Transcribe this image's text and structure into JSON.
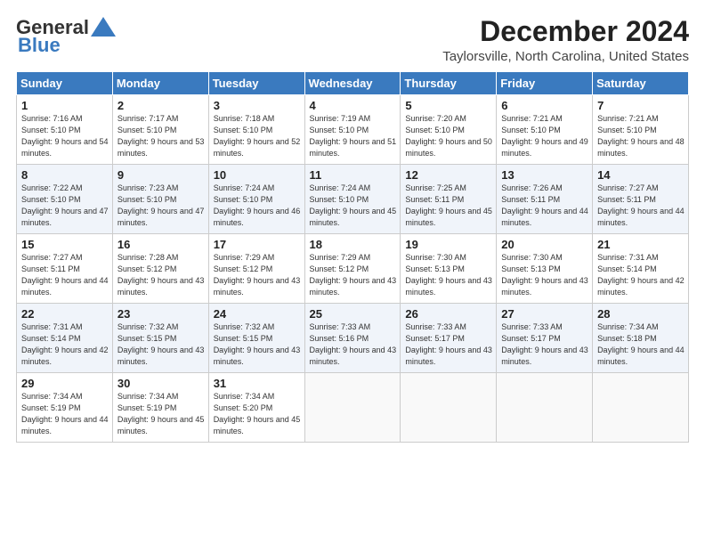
{
  "header": {
    "logo_general": "General",
    "logo_blue": "Blue",
    "month_title": "December 2024",
    "location": "Taylorsville, North Carolina, United States"
  },
  "days_of_week": [
    "Sunday",
    "Monday",
    "Tuesday",
    "Wednesday",
    "Thursday",
    "Friday",
    "Saturday"
  ],
  "weeks": [
    [
      {
        "day": "1",
        "sunrise": "Sunrise: 7:16 AM",
        "sunset": "Sunset: 5:10 PM",
        "daylight": "Daylight: 9 hours and 54 minutes."
      },
      {
        "day": "2",
        "sunrise": "Sunrise: 7:17 AM",
        "sunset": "Sunset: 5:10 PM",
        "daylight": "Daylight: 9 hours and 53 minutes."
      },
      {
        "day": "3",
        "sunrise": "Sunrise: 7:18 AM",
        "sunset": "Sunset: 5:10 PM",
        "daylight": "Daylight: 9 hours and 52 minutes."
      },
      {
        "day": "4",
        "sunrise": "Sunrise: 7:19 AM",
        "sunset": "Sunset: 5:10 PM",
        "daylight": "Daylight: 9 hours and 51 minutes."
      },
      {
        "day": "5",
        "sunrise": "Sunrise: 7:20 AM",
        "sunset": "Sunset: 5:10 PM",
        "daylight": "Daylight: 9 hours and 50 minutes."
      },
      {
        "day": "6",
        "sunrise": "Sunrise: 7:21 AM",
        "sunset": "Sunset: 5:10 PM",
        "daylight": "Daylight: 9 hours and 49 minutes."
      },
      {
        "day": "7",
        "sunrise": "Sunrise: 7:21 AM",
        "sunset": "Sunset: 5:10 PM",
        "daylight": "Daylight: 9 hours and 48 minutes."
      }
    ],
    [
      {
        "day": "8",
        "sunrise": "Sunrise: 7:22 AM",
        "sunset": "Sunset: 5:10 PM",
        "daylight": "Daylight: 9 hours and 47 minutes."
      },
      {
        "day": "9",
        "sunrise": "Sunrise: 7:23 AM",
        "sunset": "Sunset: 5:10 PM",
        "daylight": "Daylight: 9 hours and 47 minutes."
      },
      {
        "day": "10",
        "sunrise": "Sunrise: 7:24 AM",
        "sunset": "Sunset: 5:10 PM",
        "daylight": "Daylight: 9 hours and 46 minutes."
      },
      {
        "day": "11",
        "sunrise": "Sunrise: 7:24 AM",
        "sunset": "Sunset: 5:10 PM",
        "daylight": "Daylight: 9 hours and 45 minutes."
      },
      {
        "day": "12",
        "sunrise": "Sunrise: 7:25 AM",
        "sunset": "Sunset: 5:11 PM",
        "daylight": "Daylight: 9 hours and 45 minutes."
      },
      {
        "day": "13",
        "sunrise": "Sunrise: 7:26 AM",
        "sunset": "Sunset: 5:11 PM",
        "daylight": "Daylight: 9 hours and 44 minutes."
      },
      {
        "day": "14",
        "sunrise": "Sunrise: 7:27 AM",
        "sunset": "Sunset: 5:11 PM",
        "daylight": "Daylight: 9 hours and 44 minutes."
      }
    ],
    [
      {
        "day": "15",
        "sunrise": "Sunrise: 7:27 AM",
        "sunset": "Sunset: 5:11 PM",
        "daylight": "Daylight: 9 hours and 44 minutes."
      },
      {
        "day": "16",
        "sunrise": "Sunrise: 7:28 AM",
        "sunset": "Sunset: 5:12 PM",
        "daylight": "Daylight: 9 hours and 43 minutes."
      },
      {
        "day": "17",
        "sunrise": "Sunrise: 7:29 AM",
        "sunset": "Sunset: 5:12 PM",
        "daylight": "Daylight: 9 hours and 43 minutes."
      },
      {
        "day": "18",
        "sunrise": "Sunrise: 7:29 AM",
        "sunset": "Sunset: 5:12 PM",
        "daylight": "Daylight: 9 hours and 43 minutes."
      },
      {
        "day": "19",
        "sunrise": "Sunrise: 7:30 AM",
        "sunset": "Sunset: 5:13 PM",
        "daylight": "Daylight: 9 hours and 43 minutes."
      },
      {
        "day": "20",
        "sunrise": "Sunrise: 7:30 AM",
        "sunset": "Sunset: 5:13 PM",
        "daylight": "Daylight: 9 hours and 43 minutes."
      },
      {
        "day": "21",
        "sunrise": "Sunrise: 7:31 AM",
        "sunset": "Sunset: 5:14 PM",
        "daylight": "Daylight: 9 hours and 42 minutes."
      }
    ],
    [
      {
        "day": "22",
        "sunrise": "Sunrise: 7:31 AM",
        "sunset": "Sunset: 5:14 PM",
        "daylight": "Daylight: 9 hours and 42 minutes."
      },
      {
        "day": "23",
        "sunrise": "Sunrise: 7:32 AM",
        "sunset": "Sunset: 5:15 PM",
        "daylight": "Daylight: 9 hours and 43 minutes."
      },
      {
        "day": "24",
        "sunrise": "Sunrise: 7:32 AM",
        "sunset": "Sunset: 5:15 PM",
        "daylight": "Daylight: 9 hours and 43 minutes."
      },
      {
        "day": "25",
        "sunrise": "Sunrise: 7:33 AM",
        "sunset": "Sunset: 5:16 PM",
        "daylight": "Daylight: 9 hours and 43 minutes."
      },
      {
        "day": "26",
        "sunrise": "Sunrise: 7:33 AM",
        "sunset": "Sunset: 5:17 PM",
        "daylight": "Daylight: 9 hours and 43 minutes."
      },
      {
        "day": "27",
        "sunrise": "Sunrise: 7:33 AM",
        "sunset": "Sunset: 5:17 PM",
        "daylight": "Daylight: 9 hours and 43 minutes."
      },
      {
        "day": "28",
        "sunrise": "Sunrise: 7:34 AM",
        "sunset": "Sunset: 5:18 PM",
        "daylight": "Daylight: 9 hours and 44 minutes."
      }
    ],
    [
      {
        "day": "29",
        "sunrise": "Sunrise: 7:34 AM",
        "sunset": "Sunset: 5:19 PM",
        "daylight": "Daylight: 9 hours and 44 minutes."
      },
      {
        "day": "30",
        "sunrise": "Sunrise: 7:34 AM",
        "sunset": "Sunset: 5:19 PM",
        "daylight": "Daylight: 9 hours and 45 minutes."
      },
      {
        "day": "31",
        "sunrise": "Sunrise: 7:34 AM",
        "sunset": "Sunset: 5:20 PM",
        "daylight": "Daylight: 9 hours and 45 minutes."
      },
      null,
      null,
      null,
      null
    ]
  ]
}
